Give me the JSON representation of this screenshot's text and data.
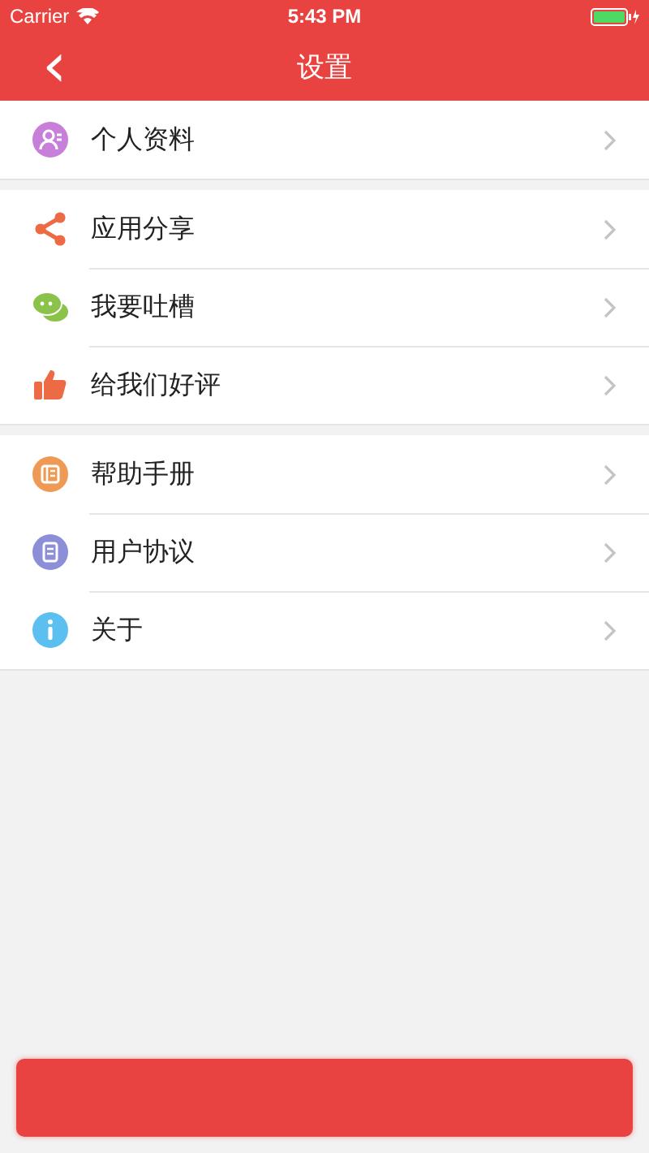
{
  "status_bar": {
    "carrier": "Carrier",
    "time": "5:43 PM"
  },
  "nav_bar": {
    "back": "‹",
    "title": "设置"
  },
  "groups": [
    {
      "items": [
        {
          "kind": "profile",
          "label": "个人资料"
        }
      ]
    },
    {
      "items": [
        {
          "kind": "share",
          "label": "应用分享"
        },
        {
          "kind": "chat",
          "label": "我要吐槽"
        },
        {
          "kind": "thumb",
          "label": "给我们好评"
        }
      ]
    },
    {
      "items": [
        {
          "kind": "help",
          "label": "帮助手册"
        },
        {
          "kind": "agreement",
          "label": "用户协议"
        },
        {
          "kind": "info",
          "label": "关于"
        }
      ]
    }
  ]
}
